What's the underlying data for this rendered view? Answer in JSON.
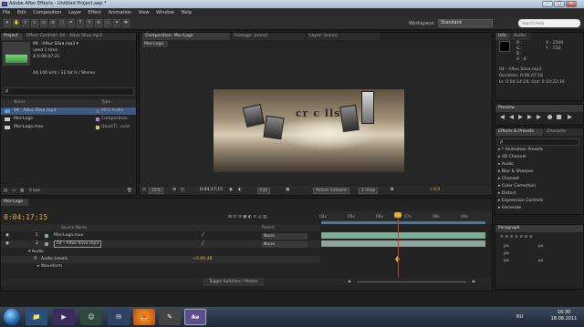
{
  "window": {
    "title": "Adobe After Effects - Untitled Project.aep *",
    "app_badge": "Ae"
  },
  "menu": [
    "File",
    "Edit",
    "Composition",
    "Layer",
    "Effect",
    "Animation",
    "View",
    "Window",
    "Help"
  ],
  "workspace": {
    "label": "Workspace:",
    "value": "Standard",
    "search_placeholder": "Search Help"
  },
  "project_panel": {
    "tabs": [
      "Project",
      "Effect Controls: 04 - Altus Sliva.mp3"
    ],
    "selected_name": "04 - Altus Sliva.mp3 ▾",
    "info_lines": [
      "used 1 time",
      "Δ 0:06:07:21",
      "44,100 kHz / 32 bit U / Stereo"
    ],
    "columns": {
      "name": "Name",
      "type": "Type"
    },
    "items": [
      {
        "name": "04 - Altus Sliva.mp3",
        "type": "MP3 Audio",
        "icon_color": "#5a9bd8",
        "label_color": "#6d6d6d",
        "selected": true
      },
      {
        "name": "Mor-Logo",
        "type": "Composition",
        "icon_color": "#c9c9c9",
        "label_color": "#a884c7",
        "selected": false
      },
      {
        "name": "Mor-Logo.mov",
        "type": "QuickTi...ovie",
        "icon_color": "#c9c9c9",
        "label_color": "#d7c87a",
        "selected": false
      }
    ],
    "footer": "8 bpc"
  },
  "comp_panel": {
    "tabs": [
      "Composition: Mor-Logo",
      "Footage: (none)",
      "Layer: (none)"
    ],
    "comp_name": "Mor-Logo",
    "logo_text": "cr c lls ",
    "footer": {
      "zoom": "25%",
      "timecode": "0;04;17;15",
      "resolution": "Full",
      "camera": "Active Camera",
      "views": "1 View",
      "exposure": "+0.0"
    }
  },
  "info_panel": {
    "tabs": [
      "Info",
      "Audio"
    ],
    "rgb": [
      "R :",
      "G :",
      "B :",
      "A : 0"
    ],
    "coords": [
      "X : 2500",
      "Y : 718"
    ],
    "file": "04 - Altus Sliva.mp3",
    "duration": "Duration: 0:06:07:18",
    "inout": "In: 0:04:14:24, Out: 0:10:22:16"
  },
  "preview_panel": {
    "title": "Preview"
  },
  "effects_panel": {
    "tabs": [
      "Effects & Presets",
      "Characte"
    ],
    "search": "ρ",
    "items": [
      "* Animation Presets",
      "3D Channel",
      "Audio",
      "Blur & Sharpen",
      "Channel",
      "Color Correction",
      "Distort",
      "Expression Controls",
      "Generate"
    ]
  },
  "paragraph_panel": {
    "title": "Paragraph",
    "fields": [
      "px",
      "px",
      "px",
      "px",
      "px"
    ]
  },
  "timeline": {
    "tab": "Mor-Logo",
    "timecode": "0:04:17:15",
    "columns": {
      "source": "Source Name",
      "parent": "Parent"
    },
    "layers": [
      {
        "num": "1",
        "name": "Mor-Logo.mov",
        "parent": "None",
        "bar_color": "#7dae94"
      },
      {
        "num": "2",
        "name": "04 - Altus Sliva.mp3",
        "parent": "None",
        "bar_color": "#8fa39a"
      }
    ],
    "sub": {
      "audio": "Audio",
      "levels_label": "Audio Levels",
      "levels_value": "+0.00 dB",
      "waveform": "Waveform"
    },
    "ruler": [
      "04s",
      "05s",
      "06s",
      "07s",
      "08s",
      "09s"
    ],
    "footer": "Toggle Switches / Modes"
  },
  "taskbar": {
    "lang": "RU",
    "time": "16:30",
    "date": "18.08.2011",
    "active_badge": "Ae"
  }
}
